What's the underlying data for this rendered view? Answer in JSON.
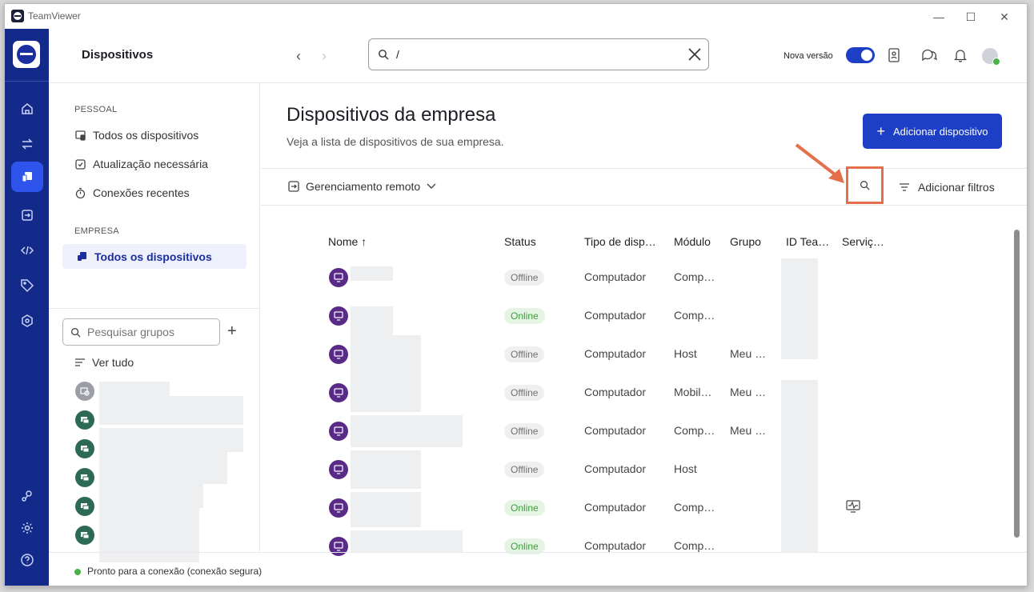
{
  "window": {
    "app_name": "TeamViewer"
  },
  "topbar": {
    "title": "Dispositivos",
    "search_value": "/",
    "new_version_label": "Nova versão",
    "new_version_enabled": true
  },
  "sidebar": {
    "personal_label": "PESSOAL",
    "personal_items": [
      "Todos os dispositivos",
      "Atualização necessária",
      "Conexões recentes"
    ],
    "company_label": "EMPRESA",
    "company_items": [
      "Todos os dispositivos"
    ],
    "group_search_placeholder": "Pesquisar grupos",
    "view_all": "Ver tudo"
  },
  "content": {
    "heading": "Dispositivos da empresa",
    "subheading": "Veja a lista de dispositivos de sua empresa.",
    "add_device_label": "Adicionar dispositivo",
    "remote_mgmt_label": "Gerenciamento remoto",
    "add_filters_label": "Adicionar filtros"
  },
  "table": {
    "columns": [
      "Nome ↑",
      "Status",
      "Tipo de disp…",
      "Módulo",
      "Grupo",
      "ID Tea…",
      "Serviç…"
    ],
    "rows": [
      {
        "status": "Offline",
        "type": "Computador",
        "module": "Comp…",
        "group": ""
      },
      {
        "status": "Online",
        "type": "Computador",
        "module": "Comp…",
        "group": ""
      },
      {
        "status": "Offline",
        "type": "Computador",
        "module": "Host",
        "group": "Meu …"
      },
      {
        "status": "Offline",
        "type": "Computador",
        "module": "Mobil…",
        "group": "Meu …"
      },
      {
        "status": "Offline",
        "type": "Computador",
        "module": "Comp…",
        "group": "Meu …"
      },
      {
        "status": "Offline",
        "type": "Computador",
        "module": "Host",
        "group": ""
      },
      {
        "status": "Online",
        "type": "Computador",
        "module": "Comp…",
        "group": ""
      },
      {
        "status": "Online",
        "type": "Computador",
        "module": "Comp…",
        "group": ""
      }
    ]
  },
  "statusbar": {
    "text": "Pronto para a conexão (conexão segura)"
  },
  "colors": {
    "rail": "#132a8a",
    "accent": "#1d3fc6",
    "device_icon": "#5a2a88",
    "annotation": "#e3704a"
  }
}
